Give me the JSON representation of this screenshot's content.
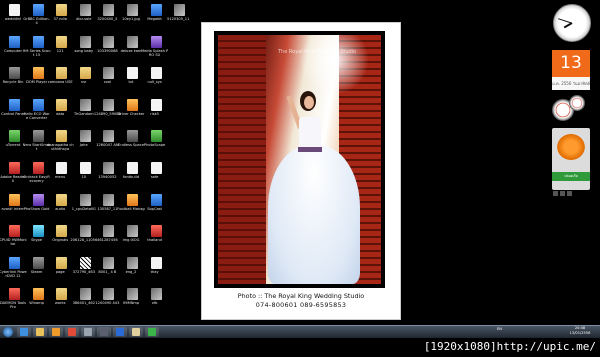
{
  "desktop": {
    "icons": [
      [
        {
          "label": "wedddinl",
          "g": "g-doc"
        },
        {
          "label": "Computer",
          "g": "g-blue"
        },
        {
          "label": "Recycle Bin",
          "g": "g-grey"
        },
        {
          "label": "Control Panel",
          "g": "g-blue"
        },
        {
          "label": "uTorrent",
          "g": "g-green"
        },
        {
          "label": "Adobe Reader X",
          "g": "g-red"
        },
        {
          "label": "avast! Intern",
          "g": "g-orange"
        },
        {
          "label": "CPUID HWMonitor",
          "g": "g-red"
        },
        {
          "label": "Cyberlink PowerDVD 12",
          "g": "g-blue"
        },
        {
          "label": "DAEMON Tools Pro",
          "g": "g-red"
        }
      ],
      [
        {
          "label": "GrBBC Edition-4",
          "g": "g-blue"
        },
        {
          "label": "HM Series Scout 15",
          "g": "g-blue"
        },
        {
          "label": "DOM Player",
          "g": "g-orange"
        },
        {
          "label": "Hello ECO Ware Converter",
          "g": "g-blue"
        },
        {
          "label": "Nero StartSmart",
          "g": "g-grey"
        },
        {
          "label": "Ontrack EasyRecovery",
          "g": "g-red"
        },
        {
          "label": "PhoShow Gold",
          "g": "g-purple"
        },
        {
          "label": "Skype",
          "g": "g-cyan"
        },
        {
          "label": "Steam",
          "g": "g-grey"
        },
        {
          "label": "Winamp",
          "g": "g-orange"
        }
      ],
      [
        {
          "label": "37 ndia",
          "g": "g-folder"
        },
        {
          "label": "121",
          "g": "g-folder"
        },
        {
          "label": "comoana USE",
          "g": "g-folder"
        },
        {
          "label": "data",
          "g": "g-folder"
        },
        {
          "label": "doanapatha chuthidhaya",
          "g": "g-folder"
        },
        {
          "label": "menu",
          "g": "g-doc"
        },
        {
          "label": "audio",
          "g": "g-folder"
        },
        {
          "label": "Originals",
          "g": "g-folder"
        },
        {
          "label": "page",
          "g": "g-folder"
        },
        {
          "label": "works",
          "g": "g-folder"
        }
      ],
      [
        {
          "label": "dior-sale",
          "g": "g-photo"
        },
        {
          "label": "song baby",
          "g": "g-photo"
        },
        {
          "label": "vsr",
          "g": "g-folder"
        },
        {
          "label": "ThGandom",
          "g": "g-photo"
        },
        {
          "label": "Jahe",
          "g": "g-photo"
        },
        {
          "label": "10",
          "g": "g-doc"
        },
        {
          "label": "1_cpuDetailG",
          "g": "g-photo"
        },
        {
          "label": "206128_11056",
          "g": "g-photo"
        },
        {
          "label": "372790_463",
          "g": "g-qr"
        },
        {
          "label": "386401_462",
          "g": "g-photo"
        }
      ],
      [
        {
          "label": "3200400_5",
          "g": "g-photo"
        },
        {
          "label": "103390068",
          "g": "g-photo"
        },
        {
          "label": "cool",
          "g": "g-photo"
        },
        {
          "label": "124890_59080",
          "g": "g-photo"
        },
        {
          "label": "1260047 AN",
          "g": "g-photo"
        },
        {
          "label": "13940052",
          "g": "g-photo"
        },
        {
          "label": "130587_11",
          "g": "g-photo"
        },
        {
          "label": "461287456",
          "g": "g-photo"
        },
        {
          "label": "8001_ 4 B",
          "g": "g-photo"
        },
        {
          "label": "1200490 443",
          "g": "g-photo"
        }
      ],
      [
        {
          "label": "10ey1.jpg",
          "g": "g-photo"
        },
        {
          "label": "deluxe kam",
          "g": "g-photo"
        },
        {
          "label": "txt",
          "g": "g-doc"
        },
        {
          "label": "Driver Checker",
          "g": "g-orange"
        },
        {
          "label": "Endless Space",
          "g": "g-grey"
        },
        {
          "label": "fontbuild",
          "g": "g-doc"
        },
        {
          "label": "Football Manag",
          "g": "g-orange"
        },
        {
          "label": "img IXOG",
          "g": "g-photo"
        },
        {
          "label": "img_2",
          "g": "g-photo"
        },
        {
          "label": "IHIMNmp",
          "g": "g-photo"
        }
      ],
      [
        {
          "label": "Megabit",
          "g": "g-blue"
        },
        {
          "label": "Media Splash PRO SU",
          "g": "g-purple"
        },
        {
          "label": "null_sys",
          "g": "g-doc"
        },
        {
          "label": "risk5",
          "g": "g-doc"
        },
        {
          "label": "PhotoScape",
          "g": "g-green"
        },
        {
          "label": "safe",
          "g": "g-doc"
        },
        {
          "label": "SopCast",
          "g": "g-blue"
        },
        {
          "label": "thailand",
          "g": "g-red"
        },
        {
          "label": "thay",
          "g": "g-doc"
        },
        {
          "label": "xfb",
          "g": "g-photo"
        }
      ],
      [
        {
          "label": "5120305_11",
          "g": "g-photo"
        },
        {
          "label": "",
          "g": ""
        },
        {
          "label": "",
          "g": ""
        },
        {
          "label": "",
          "g": ""
        },
        {
          "label": "",
          "g": ""
        },
        {
          "label": "",
          "g": ""
        },
        {
          "label": "",
          "g": ""
        },
        {
          "label": "",
          "g": ""
        },
        {
          "label": "",
          "g": ""
        },
        {
          "label": "",
          "g": ""
        }
      ]
    ]
  },
  "photo": {
    "watermark": "The Royal King Wedding Studio",
    "caption_line1": "Photo :: The Royal King Wedding Studio",
    "caption_line2": "074-800601    089-6595853"
  },
  "gadgets": {
    "calendar_day": "13",
    "calendar_month": "ม.ค. 2556 วันอาทิตย์",
    "avast_status": "ปลอดภัย"
  },
  "taskbar": {
    "language": "EN",
    "time": "20:48",
    "date": "13/01/2556",
    "pinned": [
      {
        "name": "ie-icon",
        "color": "#3d8fe0"
      },
      {
        "name": "explorer-icon",
        "color": "#e8c15a"
      },
      {
        "name": "media-player-icon",
        "color": "#f09a2a"
      },
      {
        "name": "chrome-icon",
        "color": "#e24a3a"
      },
      {
        "name": "tool-icon",
        "color": "#9aa3b0"
      },
      {
        "name": "movie-icon",
        "color": "#5a6070"
      },
      {
        "name": "jp-icon",
        "color": "#2b6ad6"
      },
      {
        "name": "photo-icon",
        "color": "#e0d0a0"
      },
      {
        "name": "utorrent-icon",
        "color": "#3bb54a"
      }
    ]
  },
  "footer": {
    "resolution_caption": "[1920x1080]http://upic.me/"
  }
}
